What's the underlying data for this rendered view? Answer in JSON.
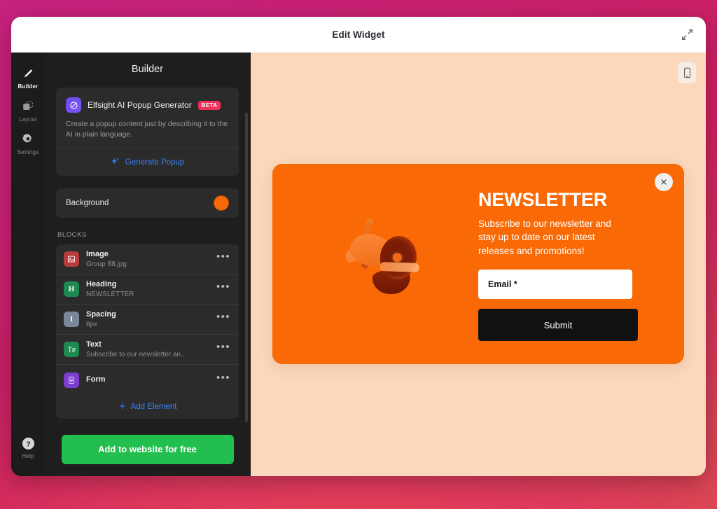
{
  "window": {
    "title": "Edit Widget",
    "expand_icon": "expand-arrows-icon"
  },
  "rail": {
    "items": [
      {
        "label": "Builder",
        "icon": "pen-icon",
        "active": true
      },
      {
        "label": "Layout",
        "icon": "layout-icon",
        "active": false
      },
      {
        "label": "Settings",
        "icon": "gear-icon",
        "active": false
      }
    ],
    "help": {
      "label": "Help",
      "icon": "question-mark-icon"
    }
  },
  "builder": {
    "header": "Builder",
    "ai_card": {
      "logo_icon": "elfsight-logo-icon",
      "title": "Elfsight AI Popup Generator",
      "badge": "BETA",
      "description": "Create a popup content just by describing it to the AI in plain language.",
      "generate_label": "Generate Popup",
      "generate_icon": "sparkles-icon"
    },
    "background": {
      "label": "Background",
      "color": "#F96A07"
    },
    "blocks_title": "BLOCKS",
    "blocks": [
      {
        "name": "Image",
        "sub": "Group 88.jpg",
        "icon": "image-icon",
        "icon_glyph": "",
        "icon_color": "#b93c3c",
        "menu_icon": "more-options-icon"
      },
      {
        "name": "Heading",
        "sub": "NEWSLETTER",
        "icon": "heading-icon",
        "icon_glyph": "H",
        "icon_color": "#1e8a52",
        "menu_icon": "more-options-icon"
      },
      {
        "name": "Spacing",
        "sub": "8px",
        "icon": "spacing-icon",
        "icon_glyph": "I",
        "icon_color": "#7b8699",
        "menu_icon": "more-options-icon"
      },
      {
        "name": "Text",
        "sub": "Subscribe to our newsletter an...",
        "icon": "text-icon",
        "icon_glyph": "T",
        "icon_color": "#1e8a52",
        "menu_icon": "more-options-icon"
      },
      {
        "name": "Form",
        "sub": "",
        "icon": "form-icon",
        "icon_glyph": "",
        "icon_color": "#7b3ecf",
        "menu_icon": "more-options-icon"
      }
    ],
    "add_element": "Add Element",
    "add_element_icon": "plus-icon",
    "cta": "Add to website for free"
  },
  "preview": {
    "device_toggle_icon": "mobile-device-icon",
    "background_color": "#FBD8BB",
    "popup": {
      "background_color": "#F96A07",
      "close_icon": "close-icon",
      "image_alt": "megaphone-illustration",
      "heading": "NEWSLETTER",
      "text": "Subscribe to our newsletter and stay up to date on our latest releases and promotions!",
      "email_placeholder": "Email *",
      "email_value": "",
      "submit_label": "Submit"
    }
  }
}
